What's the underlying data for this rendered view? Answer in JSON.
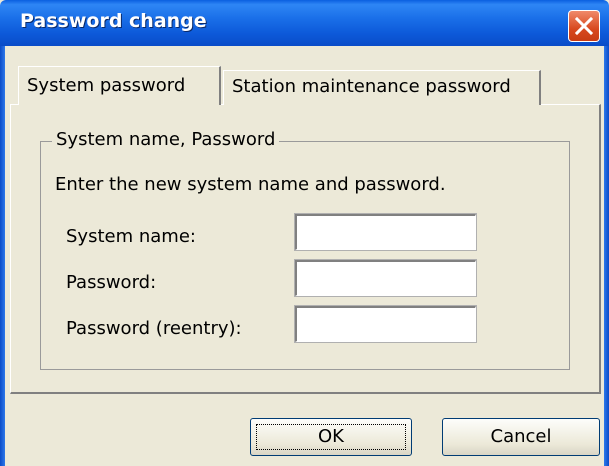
{
  "window": {
    "title": "Password change",
    "close_icon": "close-icon"
  },
  "tabs": [
    {
      "label": "System password",
      "active": true
    },
    {
      "label": "Station maintenance password",
      "active": false
    }
  ],
  "group": {
    "legend": "System name, Password",
    "instruction": "Enter the new system name and password.",
    "fields": [
      {
        "label": "System name:",
        "value": ""
      },
      {
        "label": "Password:",
        "value": ""
      },
      {
        "label": "Password (reentry):",
        "value": ""
      }
    ]
  },
  "buttons": {
    "ok_label": "OK",
    "cancel_label": "Cancel"
  },
  "colors": {
    "titlebar": "#0c58d8",
    "close": "#d8491f",
    "face": "#ece9d8"
  }
}
